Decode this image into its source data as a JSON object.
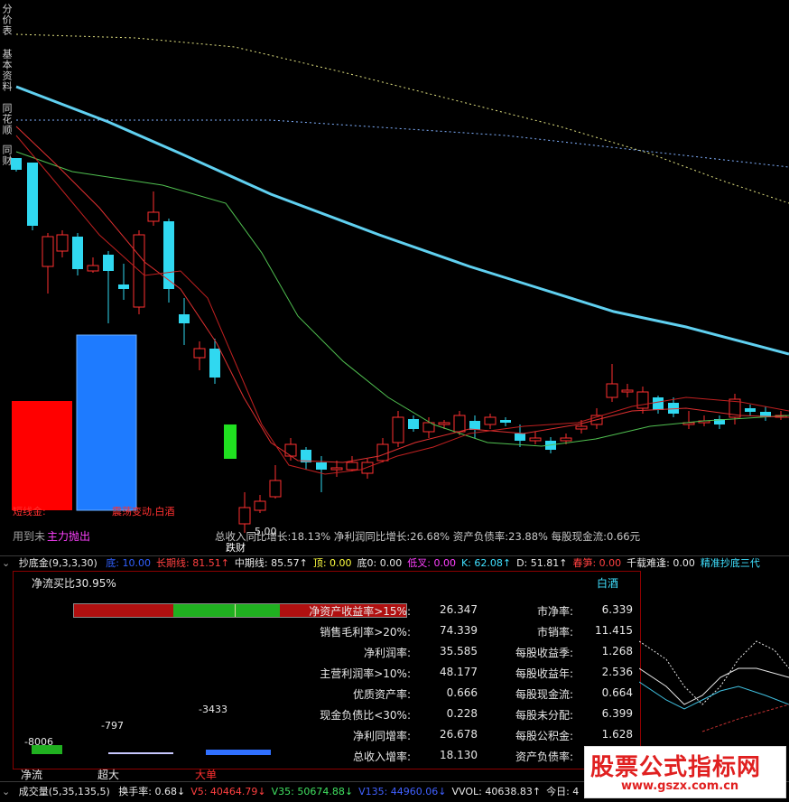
{
  "side_tabs": [
    "分价表",
    "基本资料",
    "同花顺",
    "同财"
  ],
  "chart_annotations": {
    "price_low": "5.00",
    "left_label_1": "短线金:",
    "left_label_2": "用到未",
    "left_label_3": "主力抛出",
    "center_label": "震荡变动,白酒",
    "bottom_label": "跌财",
    "fundamentals_line": "总收入同比增长:18.13%  净利润同比增长:26.68%  资产负债率:23.88%  每股现金流:0.66元"
  },
  "indicator_row": {
    "name": "抄底金(9,3,3,30)",
    "items": [
      {
        "label": "底:",
        "value": "10.00",
        "color": "#3060ff"
      },
      {
        "label": "长期线:",
        "value": "81.51↑",
        "color": "#ff4040"
      },
      {
        "label": "中期线:",
        "value": "85.57↑",
        "color": "#e8e8e8"
      },
      {
        "label": "顶:",
        "value": "0.00",
        "color": "#ffff40"
      },
      {
        "label": "底0:",
        "value": "0.00",
        "color": "#e8e8e8"
      },
      {
        "label": "低叉:",
        "value": "0.00",
        "color": "#ff40ff"
      },
      {
        "label": "K:",
        "value": "62.08↑",
        "color": "#40e0ff"
      },
      {
        "label": "D:",
        "value": "51.81↑",
        "color": "#e8e8e8"
      },
      {
        "label": "春笋:",
        "value": "0.00",
        "color": "#ff4040"
      },
      {
        "label": "千载难逢:",
        "value": "0.00",
        "color": "#e8e8e8"
      },
      {
        "label": "精准抄底三代",
        "value": "",
        "color": "#40e0ff"
      }
    ]
  },
  "panel": {
    "net_flow_ratio": "净流买比30.95%",
    "industry": "白酒",
    "left_rows": [
      {
        "label": "净资产收益率>15%:",
        "value": "26.347"
      },
      {
        "label": "销售毛利率>20%:",
        "value": "74.339"
      },
      {
        "label": "净利润率:",
        "value": "35.585"
      },
      {
        "label": "主营利润率>10%:",
        "value": "48.177"
      },
      {
        "label": "优质资产率:",
        "value": "0.666"
      },
      {
        "label": "现金负债比<30%:",
        "value": "0.228"
      },
      {
        "label": "净利同增率:",
        "value": "26.678"
      },
      {
        "label": "总收入增率:",
        "value": "18.130"
      }
    ],
    "right_rows": [
      {
        "label": "市净率:",
        "value": "6.339"
      },
      {
        "label": "市销率:",
        "value": "11.415"
      },
      {
        "label": "每股收益季:",
        "value": "1.268"
      },
      {
        "label": "每股收益年:",
        "value": "2.536"
      },
      {
        "label": "每股现金流:",
        "value": "0.664"
      },
      {
        "label": "每股未分配:",
        "value": "6.399"
      },
      {
        "label": "每股公积金:",
        "value": "1.628"
      },
      {
        "label": "资产负债率:",
        "value": ""
      }
    ],
    "flows": [
      {
        "name": "净流",
        "value": "-8006",
        "color": "#20b020"
      },
      {
        "name": "超大",
        "value": "-797",
        "color": "#c8c8ff"
      },
      {
        "name": "大单",
        "value": "-3433",
        "color": "#3070ff"
      }
    ],
    "roe_bar_pct": 62
  },
  "volume_row": {
    "name": "成交量(5,35,135,5)",
    "items": [
      {
        "label": "换手率:",
        "value": "0.68↓",
        "color": "#e8e8e8"
      },
      {
        "label": "V5:",
        "value": "40464.79↓",
        "color": "#ff4040"
      },
      {
        "label": "V35:",
        "value": "50674.88↓",
        "color": "#40e060"
      },
      {
        "label": "V135:",
        "value": "44960.06↓",
        "color": "#4060ff"
      },
      {
        "label": "VVOL:",
        "value": "40638.83↑",
        "color": "#e8e8e8"
      },
      {
        "label": "今日:",
        "value": "4",
        "color": "#e8e8e8"
      }
    ]
  },
  "watermark": {
    "title": "股票公式指标网",
    "url": "www.gszx.com.cn"
  },
  "colors": {
    "up": "#ff3030",
    "down": "#30d8f0",
    "panel_border": "#8b0000"
  }
}
